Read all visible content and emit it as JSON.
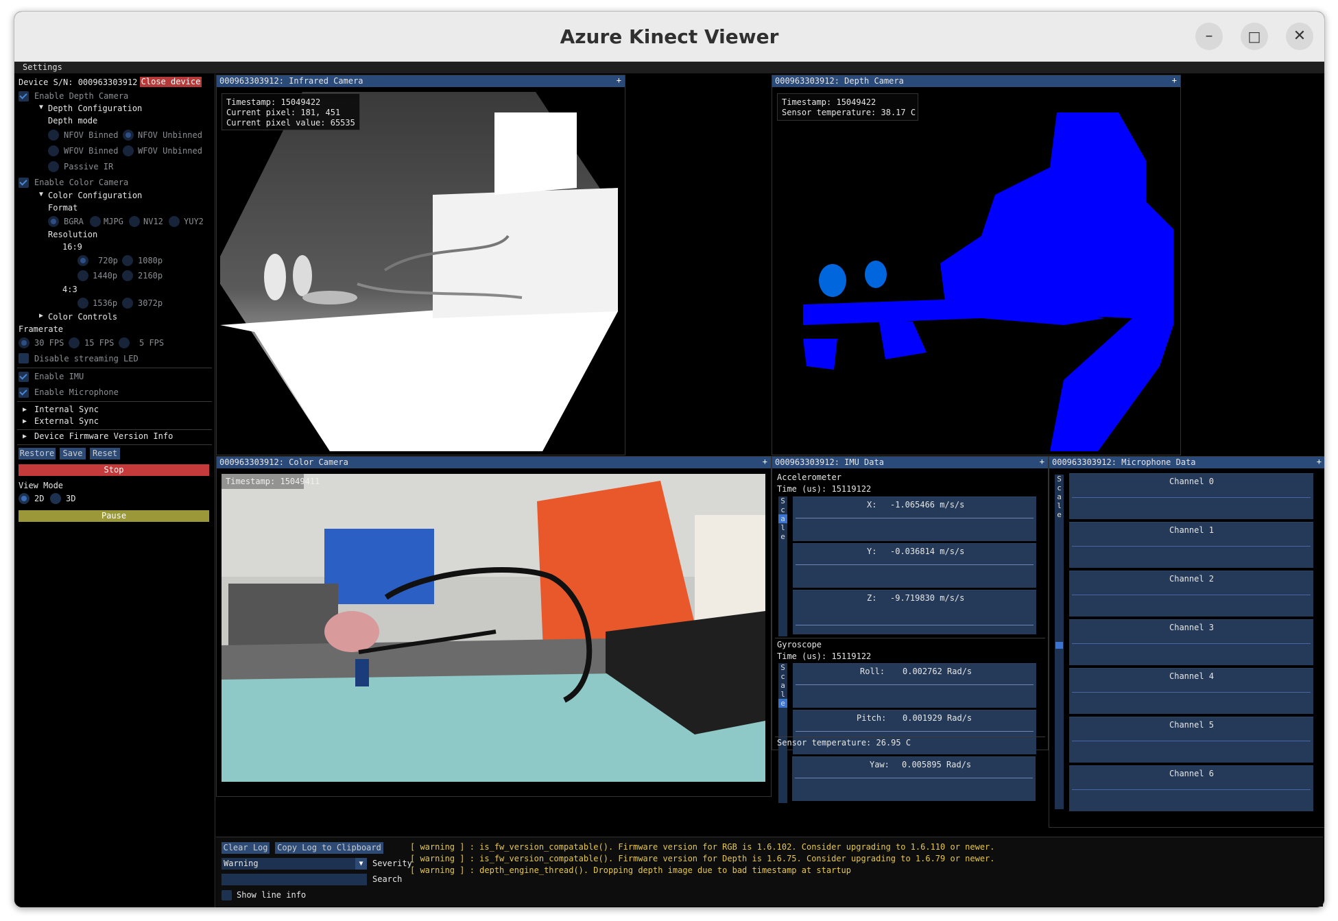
{
  "window": {
    "title": "Azure Kinect Viewer",
    "min_icon": "minimize-icon",
    "max_icon": "maximize-icon",
    "close_icon": "close-icon"
  },
  "menu": {
    "settings": "Settings"
  },
  "sidebar": {
    "device_sn": "Device S/N: 000963303912",
    "close_device": "Close device",
    "enable_depth": "Enable Depth Camera",
    "depth_config": "Depth Configuration",
    "depth_mode": "Depth mode",
    "depth_modes": [
      "NFOV Binned",
      "NFOV Unbinned",
      "WFOV Binned",
      "WFOV Unbinned",
      "Passive IR"
    ],
    "enable_color": "Enable Color Camera",
    "color_config": "Color Configuration",
    "format": "Format",
    "formats": [
      "BGRA",
      "MJPG",
      "NV12",
      "YUY2"
    ],
    "resolution": "Resolution",
    "ratio_169": "16:9",
    "res_169": [
      "720p",
      "1080p",
      "1440p",
      "2160p"
    ],
    "ratio_43": "4:3",
    "res_43": [
      "1536p",
      "3072p"
    ],
    "color_controls": "Color Controls",
    "framerate": "Framerate",
    "fps": [
      "30 FPS",
      "15 FPS",
      "5 FPS"
    ],
    "disable_led": "Disable streaming LED",
    "enable_imu": "Enable IMU",
    "enable_mic": "Enable Microphone",
    "internal_sync": "Internal Sync",
    "external_sync": "External Sync",
    "fw_info": "Device Firmware Version Info",
    "restore": "Restore",
    "save": "Save",
    "reset": "Reset",
    "stop": "Stop",
    "view_mode": "View Mode",
    "view_2d": "2D",
    "view_3d": "3D",
    "pause": "Pause"
  },
  "ir_panel": {
    "title": "000963303912: Infrared Camera",
    "plus": "+",
    "timestamp": "Timestamp: 15049422",
    "pixel": "Current pixel: 181, 451",
    "pixel_value": "Current pixel value: 65535"
  },
  "depth_panel": {
    "title": "000963303912: Depth Camera",
    "plus": "+",
    "timestamp": "Timestamp: 15049422",
    "temp": "Sensor temperature: 38.17 C"
  },
  "color_panel": {
    "title": "000963303912: Color Camera",
    "plus": "+",
    "timestamp": "Timestamp: 15049411"
  },
  "imu_panel": {
    "title": "000963303912: IMU Data",
    "plus": "+",
    "accel_label": "Accelerometer",
    "accel_time": "Time (us): 15119122",
    "accel": [
      {
        "axis": "X:",
        "value": "-1.065466 m/s/s"
      },
      {
        "axis": "Y:",
        "value": "-0.036814 m/s/s"
      },
      {
        "axis": "Z:",
        "value": "-9.719830 m/s/s"
      }
    ],
    "gyro_label": "Gyroscope",
    "gyro_time": "Time (us): 15119122",
    "gyro": [
      {
        "axis": "Roll:",
        "value": "0.002762 Rad/s"
      },
      {
        "axis": "Pitch:",
        "value": "0.001929 Rad/s"
      },
      {
        "axis": "Yaw:",
        "value": "0.005895 Rad/s"
      }
    ],
    "scale_letters": [
      "S",
      "c",
      "a",
      "l",
      "e"
    ],
    "sensor_temp": "Sensor temperature: 26.95 C"
  },
  "mic_panel": {
    "title": "000963303912: Microphone Data",
    "plus": "+",
    "channels": [
      "Channel 0",
      "Channel 1",
      "Channel 2",
      "Channel 3",
      "Channel 4",
      "Channel 5",
      "Channel 6"
    ]
  },
  "log": {
    "clear": "Clear Log",
    "copy": "Copy Log to Clipboard",
    "severity_value": "Warning",
    "severity_label": "Severity",
    "search_label": "Search",
    "show_line_info": "Show line info",
    "lines": [
      "[ warning  ] : is_fw_version_compatable(). Firmware version for RGB is 1.6.102. Consider upgrading to 1.6.110 or newer.",
      "[ warning  ] : is_fw_version_compatable(). Firmware version for Depth is 1.6.75. Consider upgrading to 1.6.79 or newer.",
      "[ warning  ] : depth_engine_thread(). Dropping depth image due to bad timestamp at startup"
    ]
  },
  "colors": {
    "title_bg": "#2a4a7a",
    "depth_blue": "#0000ff",
    "log_warning": "#e5c84c",
    "stop_red": "#c53a3a",
    "pause_olive": "#9a9838"
  }
}
